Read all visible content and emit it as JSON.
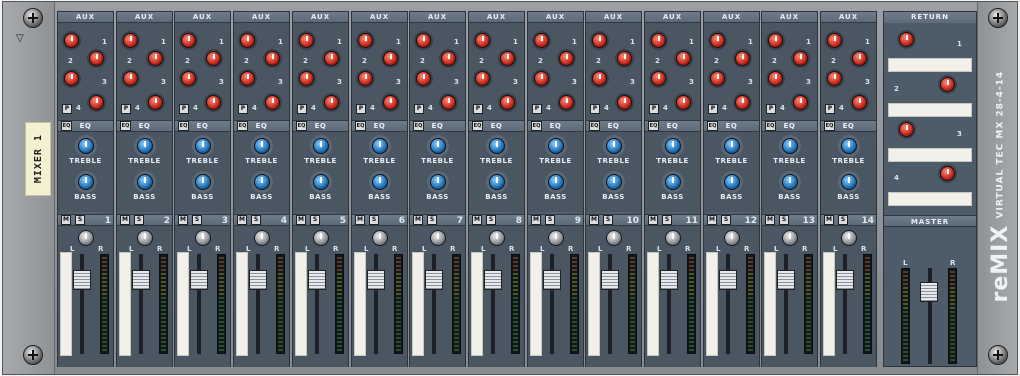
{
  "device": {
    "label": "MIXER 1",
    "brand_logo": "reMIX",
    "brand_sub": "VIRTUAL TEC MX 28-4-14",
    "fold_arrow": "▽"
  },
  "channel_labels": {
    "aux": "AUX",
    "eq_btn": "EQ",
    "eq": "EQ",
    "treble": "TREBLE",
    "bass": "BASS",
    "mute": "M",
    "solo": "S",
    "pan_l": "L",
    "pan_r": "R",
    "aux_pre": "P",
    "aux_nums": [
      "1",
      "2",
      "3",
      "4"
    ]
  },
  "channels": [
    {
      "num": "1"
    },
    {
      "num": "2"
    },
    {
      "num": "3"
    },
    {
      "num": "4"
    },
    {
      "num": "5"
    },
    {
      "num": "6"
    },
    {
      "num": "7"
    },
    {
      "num": "8"
    },
    {
      "num": "9"
    },
    {
      "num": "10"
    },
    {
      "num": "11"
    },
    {
      "num": "12"
    },
    {
      "num": "13"
    },
    {
      "num": "14"
    }
  ],
  "return_section": {
    "title": "RETURN",
    "nums": [
      "1",
      "2",
      "3",
      "4"
    ],
    "master_title": "MASTER",
    "l": "L",
    "r": "R"
  },
  "colors": {
    "aux_knob": "#c4281a",
    "eq_knob": "#1f6fb5",
    "panel": "#4a5662"
  }
}
